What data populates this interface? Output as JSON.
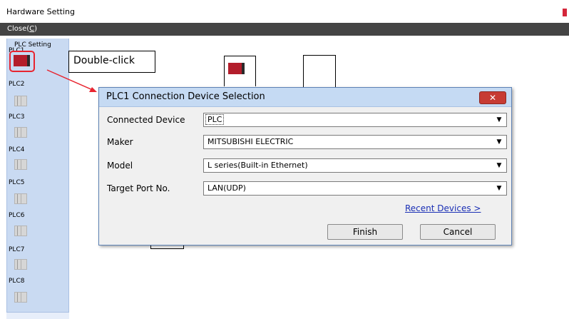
{
  "window": {
    "title": "Hardware Setting"
  },
  "toolbar": {
    "close_label": "Close(",
    "close_mnemonic": "C",
    "close_suffix": ")"
  },
  "sidebar": {
    "heading": "PLC Setting",
    "items": [
      {
        "label": "PLC1"
      },
      {
        "label": "PLC2"
      },
      {
        "label": "PLC3"
      },
      {
        "label": "PLC4"
      },
      {
        "label": "PLC5"
      },
      {
        "label": "PLC6"
      },
      {
        "label": "PLC7"
      },
      {
        "label": "PLC8"
      }
    ]
  },
  "callout": {
    "text": "Double-click"
  },
  "dialog": {
    "title": "PLC1 Connection Device Selection",
    "close_glyph": "✕",
    "fields": [
      {
        "label": "Connected Device",
        "value": "PLC"
      },
      {
        "label": "Maker",
        "value": "MITSUBISHI ELECTRIC"
      },
      {
        "label": "Model",
        "value": "L series(Built-in Ethernet)"
      },
      {
        "label": "Target Port No.",
        "value": "LAN(UDP)"
      }
    ],
    "recent_link": "Recent Devices >",
    "finish_label": "Finish",
    "cancel_label": "Cancel"
  },
  "colors": {
    "highlight": "#e8242f",
    "dialog_title_bg": "#c5daf3",
    "sidebar_bg": "#c9daf2",
    "link": "#1a2fb5"
  },
  "icons": {
    "dropdown": "chevron-down-icon",
    "plc": "plc-unit-icon",
    "close": "close-icon"
  }
}
